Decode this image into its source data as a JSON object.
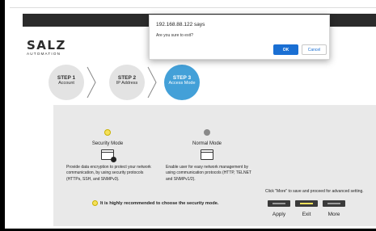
{
  "logo": {
    "main": "SALZ",
    "sub": "AUTOMATION"
  },
  "steps": [
    {
      "title": "STEP 1",
      "label": "Account"
    },
    {
      "title": "STEP 2",
      "label": "IP Address"
    },
    {
      "title": "STEP 3",
      "label": "Access Mode"
    }
  ],
  "modes": {
    "security": {
      "title": "Security Mode",
      "desc": "Provide data encryption to protect your network communication, by using security protocols (HTTPs, SSH, and SNMPv3)."
    },
    "normal": {
      "title": "Normal Mode",
      "desc": "Enable user for easy network management by using communication protocols (HTTP, TELNET and SNMPv1/2)."
    }
  },
  "hint": "It is highly recommended to choose the security mode.",
  "more_text": "Click \"More\" to save and proceed for advanced setting.",
  "actions": {
    "apply": "Apply",
    "exit": "Exit",
    "more": "More"
  },
  "dialog": {
    "title": "192.168.88.122 says",
    "message": "Are you sure to exit?",
    "ok": "OK",
    "cancel": "Cancel"
  },
  "colors": {
    "accent": "#43a0d8",
    "dialog_ok": "#1a6fd3",
    "selected": "#f5e05a"
  }
}
